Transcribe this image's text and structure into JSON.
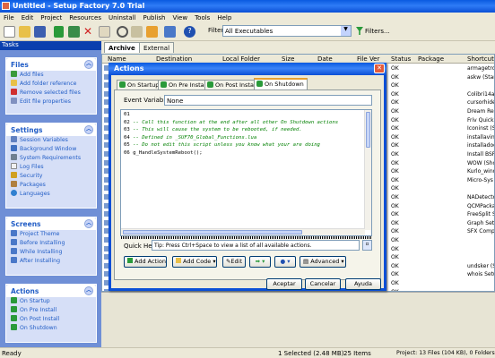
{
  "app": {
    "title": "Untitled - Setup Factory 7.0 Trial"
  },
  "menu": [
    "File",
    "Edit",
    "Project",
    "Resources",
    "Uninstall",
    "Publish",
    "View",
    "Tools",
    "Help"
  ],
  "toolbar": {
    "filter_label": "Filter:",
    "filter_value": "All Executables",
    "filters_button": "Filters..."
  },
  "tasks": {
    "header": "Tasks",
    "files": {
      "title": "Files",
      "items": [
        "Add files",
        "Add folder reference",
        "Remove selected files",
        "Edit file properties"
      ]
    },
    "settings": {
      "title": "Settings",
      "items": [
        "Session Variables",
        "Background Window",
        "System Requirements",
        "Log Files",
        "Security",
        "Packages",
        "Languages"
      ]
    },
    "screens": {
      "title": "Screens",
      "items": [
        "Project Theme",
        "Before Installing",
        "While Installing",
        "After Installing"
      ]
    },
    "actions": {
      "title": "Actions",
      "items": [
        "On Startup",
        "On Pre Install",
        "On Post Install",
        "On Shutdown"
      ]
    }
  },
  "file_tabs": [
    "Archive",
    "External"
  ],
  "grid": {
    "columns": [
      "Name",
      "Destination",
      "Local Folder",
      "Size",
      "Date",
      "File Ver",
      "Status",
      "Package",
      "Shortcut"
    ],
    "status": [
      "OK",
      "OK",
      "OK",
      "OK",
      "OK",
      "OK",
      "OK",
      "OK",
      "OK",
      "OK",
      "OK",
      "OK",
      "OK",
      "OK",
      "OK",
      "OK",
      "OK",
      "OK",
      "OK",
      "OK",
      "OK",
      "OK",
      "OK",
      "OK",
      "OK",
      "OK",
      "OK",
      "OK"
    ],
    "shortcuts": [
      "armagetro",
      "askw (Star",
      "",
      "Colibri14a",
      "cursorhide",
      "Dream Rer",
      "Friv QuickP",
      "Iconinst (S",
      "installavin",
      "installadod",
      "Install BSR",
      "WOW (Sho",
      "Kurlo_wind",
      "Micro-Sys I",
      "",
      "NADetecto",
      "QCMPacka",
      "FreeSplit S",
      "Graph Setu",
      "SFX Compil",
      "",
      "",
      "",
      "undsker (S",
      "whois Setu",
      ""
    ]
  },
  "dialog": {
    "title": "Actions",
    "tabs": [
      "On Startup",
      "On Pre Install",
      "On Post Install",
      "On Shutdown"
    ],
    "event_variables_label": "Event Variables:",
    "event_variables_value": "None",
    "code_lines": [
      {
        "num": "01",
        "text": ""
      },
      {
        "num": "02",
        "text": "-- Call this function at the end after all other On Shutdown actions"
      },
      {
        "num": "03",
        "text": "-- This will cause the system to be rebooted, if needed."
      },
      {
        "num": "04",
        "text": "-- Defined in _SUF70_Global_Functions.lua"
      },
      {
        "num": "05",
        "text": "-- Do not edit this script unless you know what your are doing"
      },
      {
        "num": "06",
        "text": "g_HandleSystemReboot();"
      }
    ],
    "quick_help_label": "Quick Help:",
    "quick_help_text": "Tip: Press Ctrl+Space to view a list of all available actions.",
    "buttons": {
      "add_action": "Add Action",
      "add_code": "Add Code",
      "edit": "Edit",
      "advanced": "Advanced"
    },
    "footer": {
      "ok": "Aceptar",
      "cancel": "Cancelar",
      "help": "Ayuda"
    }
  },
  "statusbar": {
    "ready": "Ready",
    "selected": "1 Selected (2.48 MB)",
    "items": "25 Items",
    "project": "Project: 13 Files (104 KB), 0 Folders"
  }
}
